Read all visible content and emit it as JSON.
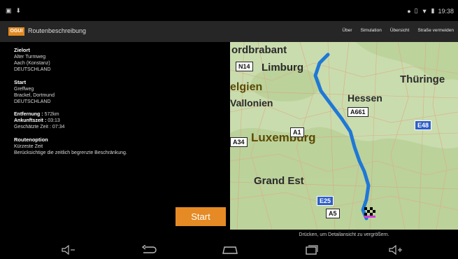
{
  "status": {
    "time": "19:38"
  },
  "app": {
    "logo": "OGUI",
    "title": "Routenbeschreibung",
    "menu": [
      "Über",
      "Simulation",
      "Übersicht",
      "Straße vermeiden"
    ]
  },
  "destination": {
    "heading": "Zielort",
    "lines": [
      "Alter Turmweg",
      "Aach (Konstanz)",
      "DEUTSCHLAND"
    ]
  },
  "start": {
    "heading": "Start",
    "lines": [
      "Greffweg",
      "Brackel, Dortmund",
      "DEUTSCHLAND"
    ]
  },
  "stats": {
    "distance_label": "Entfernung :",
    "distance_value": "572km",
    "arrival_label": "Ankunftszeit :",
    "arrival_value": "03:13",
    "eta_label": "Geschätzte Zeit :",
    "eta_value": "07:34"
  },
  "route_option": {
    "heading": "Routenoption",
    "lines": [
      "Kürzeste Zeit",
      "Berücksichtige die zeitlich begrenzte Beschränkung."
    ]
  },
  "start_button": "Start",
  "map": {
    "labels": {
      "brabant": "ordbrabant",
      "limburg": "Limburg",
      "belgien": "elgien",
      "wallonien": "Vallonien",
      "hessen": "Hessen",
      "thueringen": "Thüringe",
      "luxemburg": "Luxemburg",
      "grand_est": "Grand Est"
    },
    "shields": {
      "n14": "N14",
      "a661": "A661",
      "a1": "A1",
      "a34": "A34",
      "e48": "E48",
      "e25": "E25",
      "a5": "A5"
    },
    "caption": "Drücken, um Detailansicht zu vergrößern."
  },
  "colors": {
    "accent": "#e58a24",
    "route": "#1f78d6",
    "map_bg": "#c9dcae"
  }
}
